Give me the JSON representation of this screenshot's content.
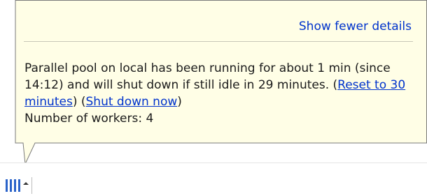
{
  "tooltip": {
    "toggle_details_link": "Show fewer details",
    "message_part1": "Parallel pool on local has been running for about 1 min (since 14:12) and will shut down if still idle in 29 minutes. (",
    "reset_link": "Reset to 30 minutes",
    "message_part2": ") (",
    "shutdown_link": "Shut down now",
    "message_part3": ")",
    "workers_label": "Number of workers: ",
    "workers_count": "4"
  },
  "statusbar": {
    "pool_icon": "parallel-pool-icon",
    "menu_icon": "caret-up-icon"
  },
  "colors": {
    "balloon_fill": "#fffee6",
    "balloon_border": "#7a7a7a",
    "link": "#0033cc",
    "pool_icon": "#2a63c9"
  }
}
